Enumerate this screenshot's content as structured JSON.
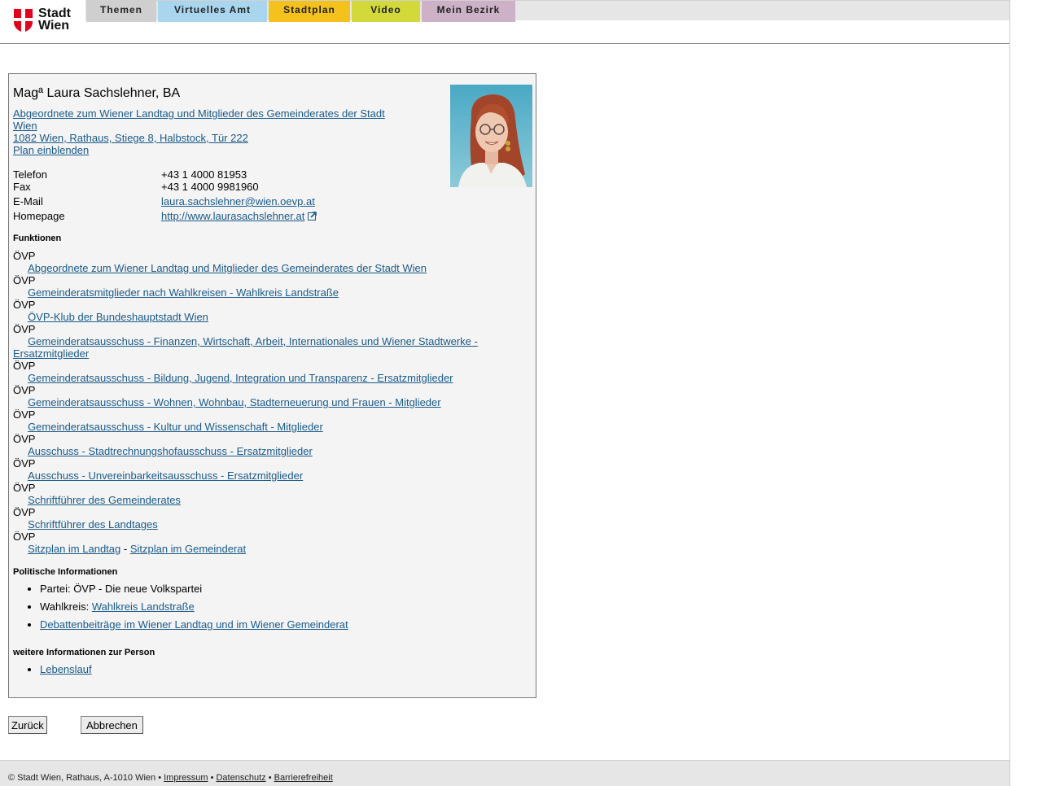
{
  "header": {
    "logo_line1": "Stadt",
    "logo_line2": "Wien",
    "tabs": [
      {
        "label": "Themen",
        "color": "#cfcfcf"
      },
      {
        "label": "Virtuelles Amt",
        "color": "#a9d6ee"
      },
      {
        "label": "Stadtplan",
        "color": "#f5c11c"
      },
      {
        "label": "Video",
        "color": "#d4d93a"
      },
      {
        "label": "Mein Bezirk",
        "color": "#cdb1c6"
      }
    ]
  },
  "person": {
    "name": "Magª Laura Sachslehner, BA",
    "role": "Abgeordnete zum Wiener Landtag und Mitglieder des Gemeinderates der Stadt Wien",
    "address": "1082 Wien, Rathaus, Stiege 8, Halbstock, Tür 222",
    "map_link": "Plan einblenden"
  },
  "contact": [
    {
      "label": "Telefon",
      "value": "+43 1 4000 81953"
    },
    {
      "label": "Fax",
      "value": "+43 1 4000 9981960"
    },
    {
      "label": "E-Mail",
      "value": "laura.sachslehner@wien.oevp.at"
    },
    {
      "label": "Homepage",
      "value": "http://www.laurasachslehner.at"
    }
  ],
  "functions": {
    "heading": "Funktionen",
    "items": [
      {
        "party": "ÖVP",
        "label": "Abgeordnete zum Wiener Landtag und Mitglieder des Gemeinderates der Stadt Wien"
      },
      {
        "party": "ÖVP",
        "label": "Gemeinderatsmitglieder nach Wahlkreisen - Wahlkreis Landstraße"
      },
      {
        "party": "ÖVP",
        "label": "ÖVP-Klub der Bundeshauptstadt Wien"
      },
      {
        "party": "ÖVP",
        "label": "Gemeinderatsausschuss - Finanzen, Wirtschaft, Arbeit, Internationales und Wiener Stadtwerke - Ersatzmitglieder"
      },
      {
        "party": "ÖVP",
        "label": "Gemeinderatsausschuss - Bildung, Jugend, Integration und Transparenz - Ersatzmitglieder"
      },
      {
        "party": "ÖVP",
        "label": "Gemeinderatsausschuss - Wohnen, Wohnbau, Stadterneuerung und Frauen - Mitglieder"
      },
      {
        "party": "ÖVP",
        "label": "Gemeinderatsausschuss - Kultur und Wissenschaft - Mitglieder"
      },
      {
        "party": "ÖVP",
        "label": "Ausschuss - Stadtrechnungshofausschuss - Ersatzmitglieder"
      },
      {
        "party": "ÖVP",
        "label": "Ausschuss - Unvereinbarkeitsausschuss - Ersatzmitglieder"
      },
      {
        "party": "ÖVP",
        "label": "Schriftführer des Gemeinderates"
      },
      {
        "party": "ÖVP",
        "label": "Schriftführer des Landtages"
      }
    ],
    "last_party": "ÖVP",
    "seat_landtag": "Sitzplan im Landtag",
    "seat_separator": " - ",
    "seat_gemeinderat": "Sitzplan im Gemeinderat"
  },
  "political": {
    "heading": "Politische Informationen",
    "party_prefix": "Partei: ",
    "party": "ÖVP - Die neue Volkspartei",
    "district_prefix": "Wahlkreis: ",
    "district": "Wahlkreis Landstraße",
    "debates": "Debattenbeiträge im Wiener Landtag und im Wiener Gemeinderat"
  },
  "more": {
    "heading": "weitere Informationen zur Person",
    "cv": "Lebenslauf"
  },
  "buttons": {
    "back": "Zurück",
    "cancel": "Abbrechen"
  },
  "footer": {
    "copyright": "© Stadt Wien, Rathaus, A-1010 Wien",
    "sep": " • ",
    "imprint": "Impressum",
    "privacy": "Datenschutz",
    "accessibility": "Barrierefreiheit"
  }
}
